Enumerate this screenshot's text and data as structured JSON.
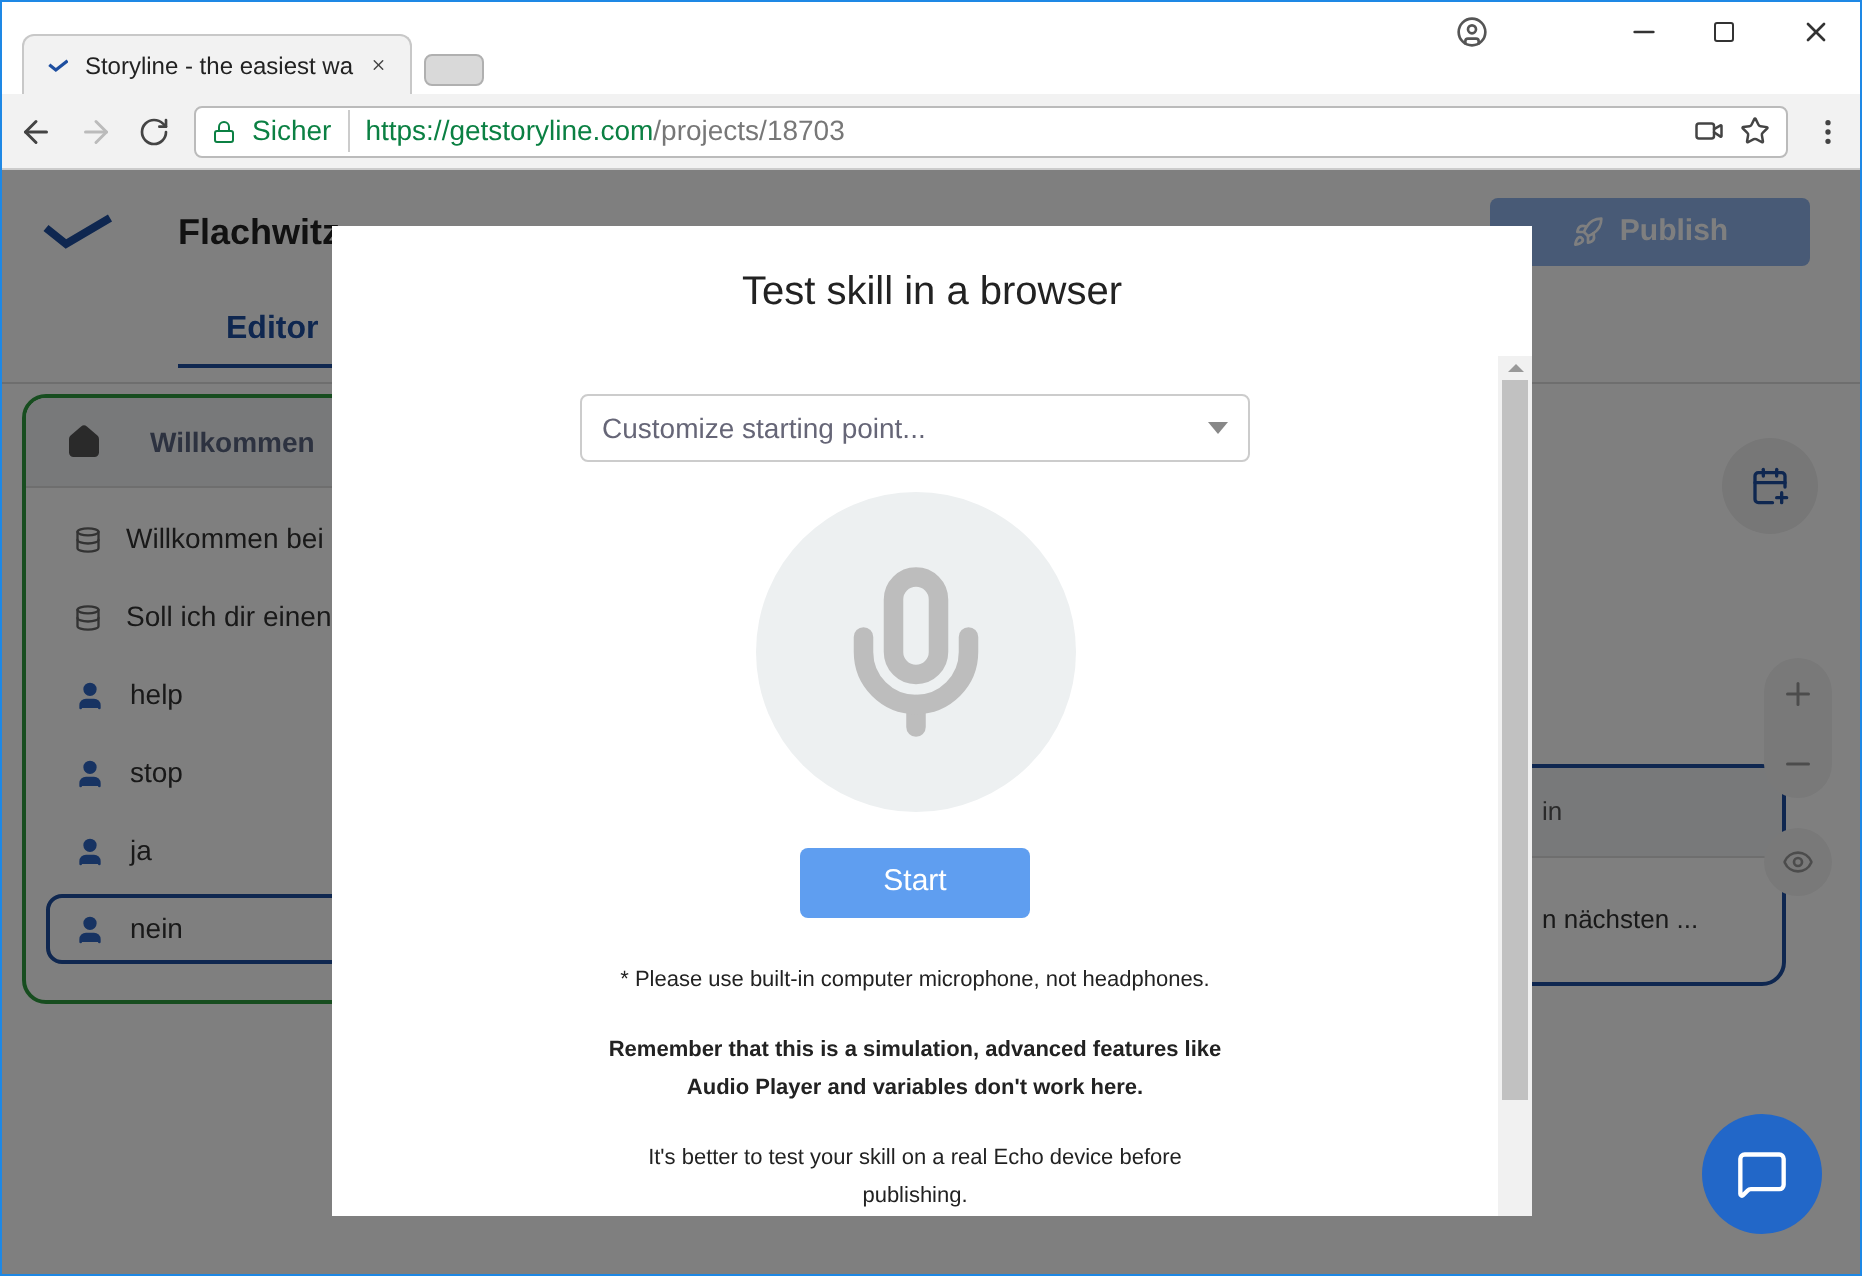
{
  "browser": {
    "tab_title": "Storyline - the easiest wa",
    "security": "Sicher",
    "url_host": "https://getstoryline.com",
    "url_path": "/projects/18703"
  },
  "app": {
    "project": "Flachwitz",
    "tabs": [
      {
        "label": "Editor",
        "selected": true
      }
    ],
    "publish": "Publish",
    "block": {
      "title": "Willkommen",
      "items": [
        {
          "kind": "message",
          "text": "Willkommen bei",
          "selected": false
        },
        {
          "kind": "message",
          "text": "Soll ich dir einen",
          "selected": false
        },
        {
          "kind": "user",
          "text": "help",
          "selected": false
        },
        {
          "kind": "user",
          "text": "stop",
          "selected": false
        },
        {
          "kind": "user",
          "text": "ja",
          "selected": false
        },
        {
          "kind": "user",
          "text": "nein",
          "selected": true
        }
      ]
    },
    "side_card": {
      "title": "in",
      "text": "n nächsten ..."
    }
  },
  "modal": {
    "title": "Test skill in a browser",
    "select": {
      "placeholder": "Customize starting point..."
    },
    "start": "Start",
    "notes": [
      {
        "text": "* Please use built-in computer microphone, not headphones.",
        "bold": false
      },
      {
        "text": "Remember that this is a simulation, advanced features like Audio Player and variables don't work here.",
        "bold": true
      },
      {
        "text": "It's better to test your skill on a real Echo device before publishing.",
        "bold": false
      }
    ]
  }
}
